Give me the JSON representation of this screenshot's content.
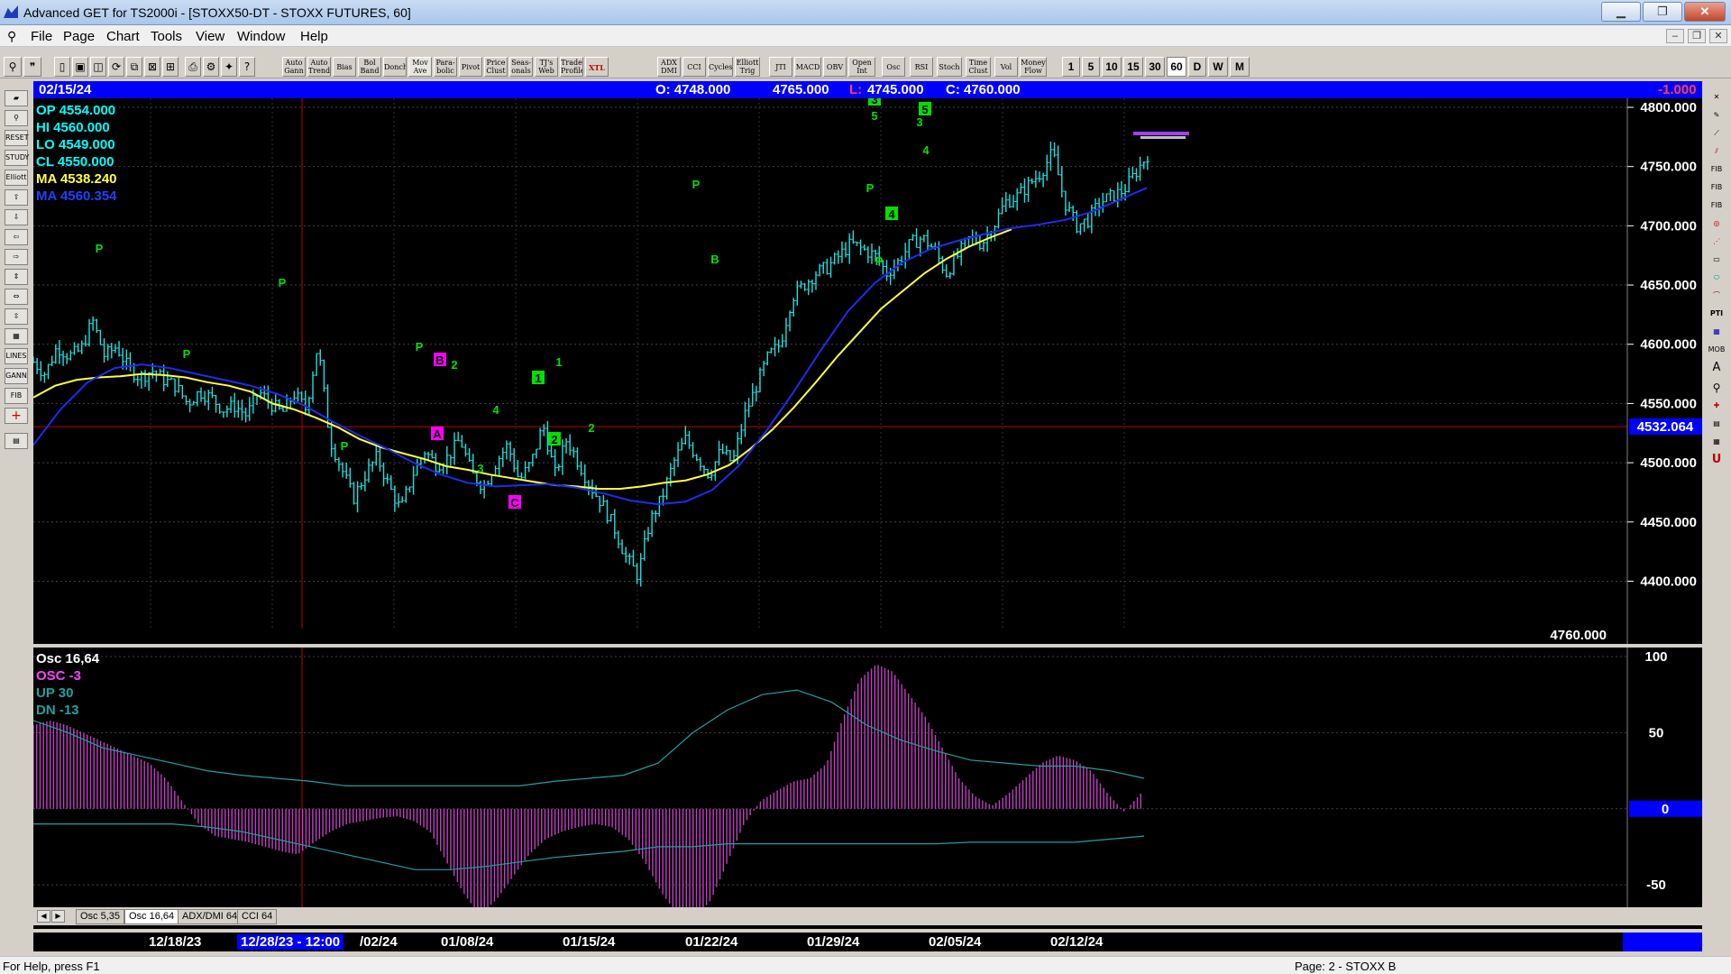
{
  "window": {
    "title": "Advanced GET for TS2000i - [STOXX50-DT - STOXX FUTURES, 60]",
    "minimize": "▁",
    "maximize": "❐",
    "close": "✕"
  },
  "menu": [
    "File",
    "Page",
    "Chart",
    "Tools",
    "View",
    "Window",
    "Help"
  ],
  "toolbar": {
    "studies": [
      "Auto Gann",
      "Auto Trend",
      "Bias",
      "Bol Band",
      "Donch",
      "Mov Ave",
      "Para-bolic",
      "Pivot",
      "Price Clust",
      "Seas-onals",
      "TJ's Web",
      "Trade Profile",
      "XTL",
      "ADX DMI",
      "CCI",
      "Cycles",
      "Elliott Trig",
      "JTI",
      "MACD",
      "OBV",
      "Open Int",
      "Osc",
      "RSI",
      "Stoch",
      "Time Clust",
      "Vol",
      "Money Flow"
    ],
    "intervals": [
      "1",
      "5",
      "10",
      "15",
      "30",
      "60",
      "D",
      "W",
      "M"
    ]
  },
  "infobar": {
    "date": "02/15/24",
    "open": "O: 4748.000",
    "high": "4765.000",
    "low_label": "L:",
    "low": "4745.000",
    "close": "C: 4760.000",
    "change": "-1.000"
  },
  "summary": {
    "op": "OP  4554.000",
    "hi": "HI   4560.000",
    "lo": "LO   4549.000",
    "cl": "CL   4550.000",
    "ma1": "MA  4538.240",
    "ma2": "MA  4560.354"
  },
  "price_axis": {
    "ticks": [
      "4800.000",
      "4750.000",
      "4700.000",
      "4650.000",
      "4600.000",
      "4550.000",
      "4500.000",
      "4450.000",
      "4400.000"
    ],
    "current_line": "4532.064",
    "last_price": "4760.000"
  },
  "osc": {
    "title": "Osc 16,64",
    "osc": "OSC -3",
    "up": "UP   30",
    "dn": "DN   -13",
    "ticks": [
      "100",
      "50",
      "0",
      "-50"
    ]
  },
  "chart_data": [
    {
      "type": "candlestick",
      "title": "STOXX50-DT - STOXX FUTURES, 60",
      "ylim": [
        4360,
        4800
      ],
      "x_labels": [
        "12/18/23",
        "12/28/23 - 12:00",
        "01/02/24",
        "01/08/24",
        "01/15/24",
        "01/22/24",
        "01/29/24",
        "02/05/24",
        "02/12/24"
      ],
      "closes": [
        4585,
        4575,
        4598,
        4590,
        4595,
        4620,
        4590,
        4598,
        4580,
        4572,
        4578,
        4570,
        4565,
        4550,
        4560,
        4555,
        4545,
        4548,
        4540,
        4560,
        4550,
        4542,
        4558,
        4545,
        4600,
        4520,
        4495,
        4470,
        4490,
        4505,
        4480,
        4460,
        4490,
        4510,
        4498,
        4505,
        4520,
        4490,
        4480,
        4500,
        4515,
        4485,
        4500,
        4532,
        4490,
        4520,
        4500,
        4480,
        4465,
        4445,
        4420,
        4405,
        4450,
        4470,
        4500,
        4520,
        4505,
        4490,
        4510,
        4500,
        4540,
        4565,
        4590,
        4600,
        4640,
        4650,
        4660,
        4665,
        4675,
        4685,
        4680,
        4675,
        4660,
        4670,
        4685,
        4690,
        4680,
        4660,
        4675,
        4690,
        4685,
        4700,
        4720,
        4725,
        4735,
        4745,
        4762,
        4720,
        4700,
        4705,
        4720,
        4725,
        4730,
        4745,
        4760
      ],
      "ma_yellow": [
        4555,
        4565,
        4570,
        4572,
        4573,
        4575,
        4574,
        4572,
        4568,
        4565,
        4560,
        4550,
        4545,
        4538,
        4530,
        4520,
        4513,
        4508,
        4503,
        4497,
        4494,
        4490,
        4487,
        4484,
        4481,
        4480,
        4478,
        4478,
        4480,
        4483,
        4485,
        4490,
        4498,
        4512,
        4528,
        4547,
        4568,
        4590,
        4610,
        4630,
        4645,
        4660,
        4672,
        4682,
        4690,
        4697
      ],
      "ma_blue": [
        4515,
        4545,
        4568,
        4580,
        4583,
        4580,
        4575,
        4570,
        4565,
        4558,
        4548,
        4535,
        4523,
        4512,
        4500,
        4490,
        4483,
        4480,
        4481,
        4482,
        4479,
        4474,
        4468,
        4465,
        4467,
        4477,
        4498,
        4527,
        4560,
        4595,
        4628,
        4652,
        4669,
        4680,
        4687,
        4693,
        4698,
        4701,
        4705,
        4712,
        4722,
        4732
      ],
      "labels": [
        {
          "text": "P",
          "kind": "pivot"
        },
        {
          "text": "P",
          "kind": "pivot"
        },
        {
          "text": "P",
          "kind": "pivot"
        },
        {
          "text": "P",
          "kind": "pivot"
        },
        {
          "text": "P",
          "kind": "pivot"
        },
        {
          "text": "P",
          "kind": "pivot"
        },
        {
          "text": "P",
          "kind": "pivot"
        },
        {
          "text": "P",
          "kind": "pivot"
        },
        {
          "text": "A",
          "kind": "abc"
        },
        {
          "text": "B",
          "kind": "abc"
        },
        {
          "text": "C",
          "kind": "abc"
        },
        {
          "text": "1",
          "kind": "wave-box"
        },
        {
          "text": "2",
          "kind": "wave-box"
        },
        {
          "text": "3",
          "kind": "wave-box"
        },
        {
          "text": "4",
          "kind": "wave-box"
        },
        {
          "text": "5",
          "kind": "wave-box"
        },
        {
          "text": "1",
          "kind": "wave"
        },
        {
          "text": "2",
          "kind": "wave"
        },
        {
          "text": "3",
          "kind": "wave"
        },
        {
          "text": "4",
          "kind": "wave"
        },
        {
          "text": "5",
          "kind": "wave"
        },
        {
          "text": "2",
          "kind": "wave"
        },
        {
          "text": "3",
          "kind": "wave"
        },
        {
          "text": "B",
          "kind": "wave"
        },
        {
          "text": "4",
          "kind": "wave"
        }
      ]
    },
    {
      "type": "bar",
      "title": "Osc 16,64",
      "ylim": [
        -60,
        100
      ],
      "values": [
        55,
        58,
        55,
        50,
        45,
        40,
        35,
        30,
        20,
        5,
        -10,
        -18,
        -20,
        -22,
        -25,
        -28,
        -30,
        -22,
        -15,
        -10,
        -8,
        -6,
        -5,
        -8,
        -15,
        -35,
        -55,
        -70,
        -60,
        -45,
        -30,
        -20,
        -15,
        -12,
        -10,
        -12,
        -20,
        -35,
        -55,
        -70,
        -72,
        -60,
        -35,
        -10,
        5,
        12,
        18,
        20,
        30,
        60,
        85,
        95,
        90,
        75,
        60,
        40,
        20,
        8,
        2,
        10,
        20,
        30,
        35,
        32,
        25,
        10,
        -2,
        10
      ],
      "up_line": [
        58,
        50,
        40,
        35,
        30,
        25,
        22,
        20,
        18,
        15,
        15,
        15,
        15,
        15,
        15,
        18,
        20,
        22,
        30,
        50,
        65,
        75,
        78,
        70,
        55,
        45,
        38,
        32,
        30,
        28,
        28,
        25,
        20
      ],
      "dn_line": [
        -10,
        -10,
        -10,
        -10,
        -10,
        -12,
        -15,
        -20,
        -25,
        -30,
        -35,
        -40,
        -40,
        -38,
        -35,
        -32,
        -30,
        -28,
        -25,
        -25,
        -23,
        -23,
        -23,
        -23,
        -23,
        -23,
        -23,
        -22,
        -22,
        -22,
        -22,
        -20,
        -18
      ]
    }
  ],
  "tabs": [
    "Osc 5,35",
    "Osc 16,64",
    "ADX/DMI 64",
    "CCI 64"
  ],
  "dates": [
    "12/18/23",
    "12/28/23 - 12:00",
    "/02/24",
    "01/08/24",
    "01/15/24",
    "01/22/24",
    "01/29/24",
    "02/05/24",
    "02/12/24"
  ],
  "status": {
    "help": "For Help, press F1",
    "page": "Page: 2 - STOXX B"
  }
}
